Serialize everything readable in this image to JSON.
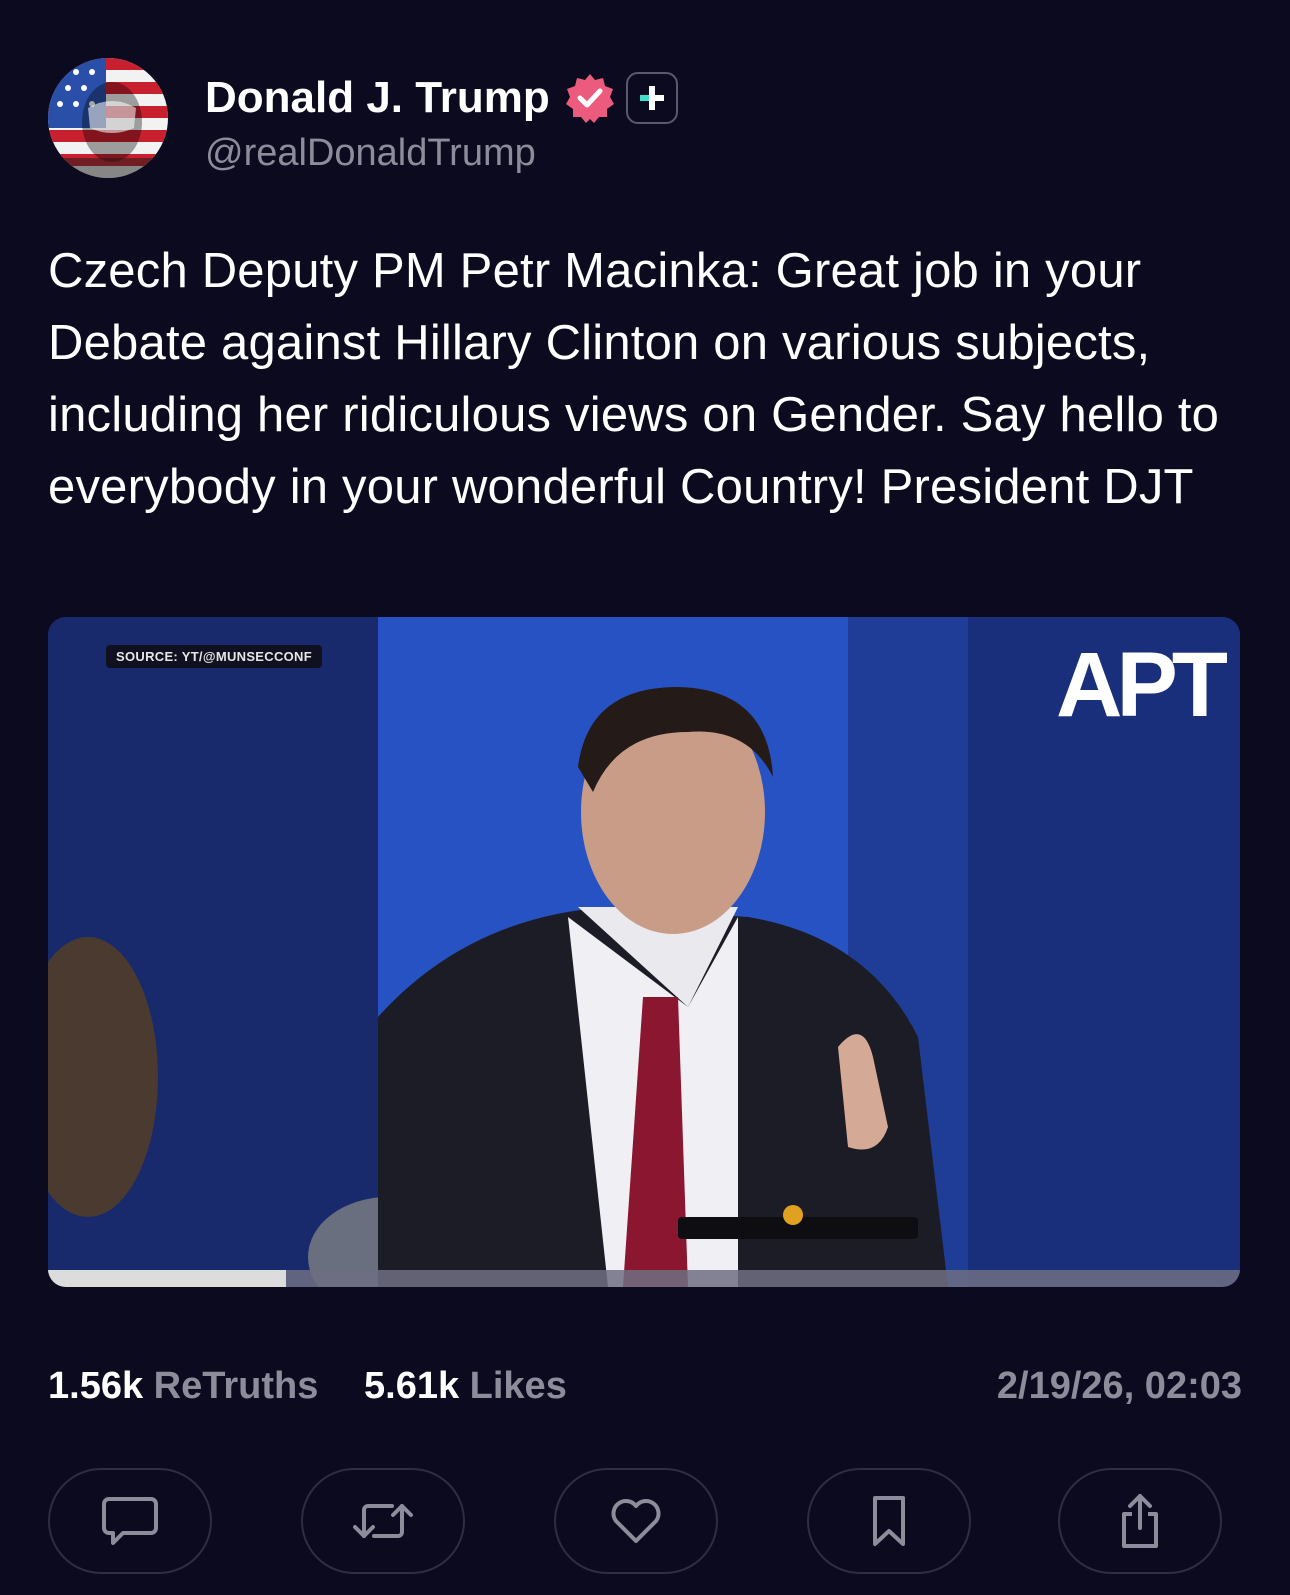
{
  "author": {
    "display_name": "Donald J. Trump",
    "handle": "@realDonaldTrump",
    "verified": true,
    "avatar_icon": "flag-portrait-avatar",
    "badge_icon": "plus-badge-icon"
  },
  "post": {
    "text": "Czech Deputy PM Petr Macinka: Great job in your Debate against Hillary Clinton on various subjects, including her ridiculous views on Gender. Say hello to everybody in your wonderful Country! President DJT"
  },
  "media": {
    "source_label": "SOURCE: YT/@MUNSECCONF",
    "logo_text": "APT",
    "progress": 0.2
  },
  "stats": {
    "retruths_count": "1.56k",
    "retruths_label": "ReTruths",
    "likes_count": "5.61k",
    "likes_label": "Likes",
    "timestamp": "2/19/26, 02:03"
  },
  "actions": [
    {
      "icon": "comment-icon"
    },
    {
      "icon": "retruth-icon"
    },
    {
      "icon": "like-icon"
    },
    {
      "icon": "bookmark-icon"
    },
    {
      "icon": "share-icon"
    }
  ],
  "colors": {
    "background": "#0b0a1f",
    "muted_text": "#8d8c9b",
    "verified_badge": "#ec5a7e",
    "badge_accent": "#3ee0c8"
  }
}
